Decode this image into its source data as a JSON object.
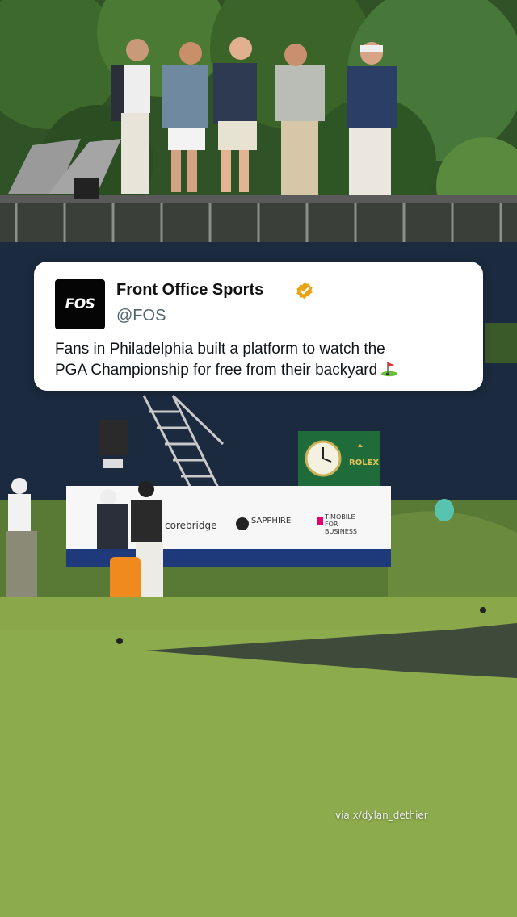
{
  "tweet": {
    "account_name": "Front Office Sports",
    "handle": "@FOS",
    "avatar_text": "FOS",
    "text_line1": "Fans in Philadelphia built a platform to watch the",
    "text_line2": "PGA Championship for free from their backyard"
  },
  "photo": {
    "credit": "via x/dylan_dethier",
    "sign_labels": [
      "corebridge",
      "SAPPHIRE",
      "T-MOBILE FOR BUSINESS"
    ],
    "clock_brand": "ROLEX"
  },
  "colors": {
    "verified_badge": "#e8a317",
    "fence": "#1b2a3e",
    "grass": "#8aa84a"
  }
}
